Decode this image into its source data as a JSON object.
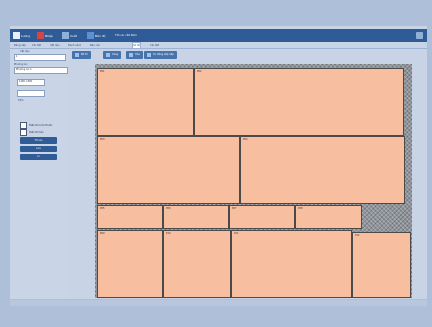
{
  "toolbar": {
    "buttons": [
      {
        "label": "Lượng",
        "icon": "square-icon"
      },
      {
        "label": "Nhập",
        "icon": "square-icon"
      },
      {
        "label": "Xuất",
        "icon": "square-icon"
      },
      {
        "label": "Bản đồ",
        "icon": "square-icon"
      }
    ],
    "title": "Tối ưu cắt tấm"
  },
  "tabs": [
    "Bảng xếp",
    "Chi tiết",
    "Vật liệu",
    "Danh sách",
    "Báo cáo",
    "Sơ đồ",
    "Cài đặt"
  ],
  "active_tab_index": 5,
  "sidebar": {
    "title_label": "Vật liệu",
    "title_value": "1",
    "section_label": "Phương án",
    "section_value": "Phương án 1",
    "field_value": "1200 x 800",
    "field_label_2": "Tấm",
    "option1": "Hiển thị kích thước",
    "option2": "Hiển thị tên",
    "button_primary": "Tối ưu",
    "button_2": "Lưu",
    "button_3": "In"
  },
  "actions": [
    {
      "label": "Bố trí"
    },
    {
      "label": "Xoay"
    },
    {
      "label": "Xóa"
    },
    {
      "label": "Tự động sắp xếp"
    }
  ],
  "pieces": [
    {
      "label": "P01"
    },
    {
      "label": "P02"
    },
    {
      "label": "P03"
    },
    {
      "label": "P04"
    },
    {
      "label": "P05"
    },
    {
      "label": "P06"
    },
    {
      "label": "P07"
    },
    {
      "label": "P08"
    },
    {
      "label": "P09"
    },
    {
      "label": "P10"
    },
    {
      "label": "P11"
    },
    {
      "label": "P12"
    }
  ],
  "colors": {
    "piece": "#f7bf9f",
    "sheet": "#8e949a",
    "toolbar": "#2f5b96",
    "background": "#aec0d9"
  }
}
